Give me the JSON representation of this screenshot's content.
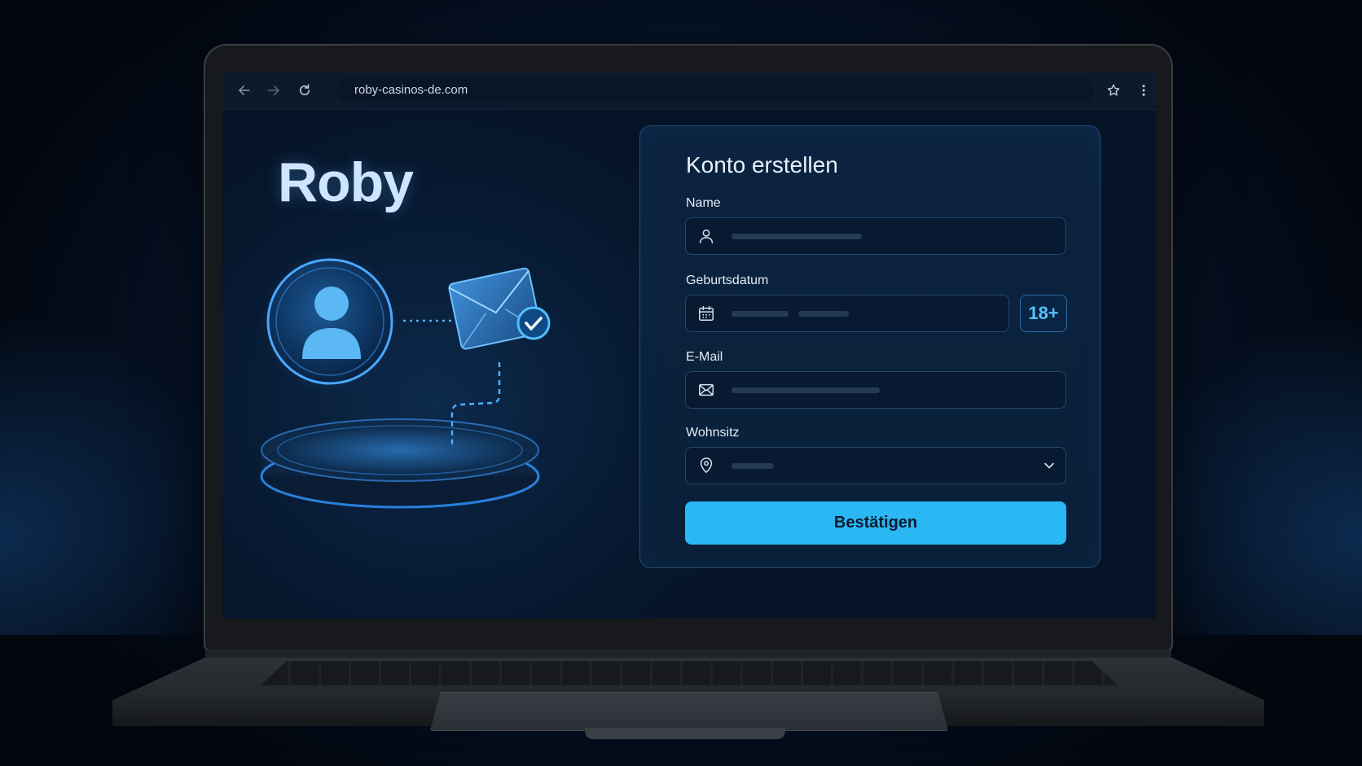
{
  "browser": {
    "url": "roby-casinos-de.com",
    "icons": [
      "arrow-left-icon",
      "arrow-right-icon",
      "reload-icon",
      "star-icon",
      "kebab-menu-icon"
    ]
  },
  "brand": {
    "name": "Roby"
  },
  "form": {
    "title": "Konto erstellen",
    "name_label": "Name",
    "birth_label": "Geburtsdatum",
    "age_badge": "18+",
    "email_label": "E-Mail",
    "residence_label": "Wohnsitz",
    "submit_label": "Bestätigen"
  },
  "colors": {
    "accent": "#2ab8f4",
    "badge_text": "#56c1ff",
    "background": "#06152a"
  }
}
